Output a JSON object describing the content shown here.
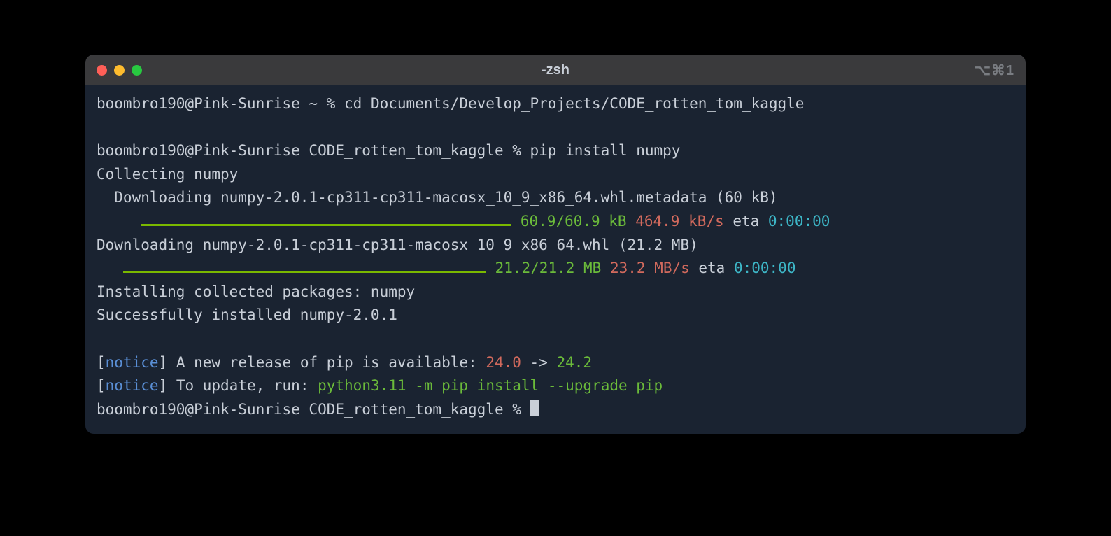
{
  "window": {
    "title": "-zsh",
    "shortcut": "⌥⌘1"
  },
  "lines": {
    "l1_prompt": "boombro190@Pink-Sunrise ~ % ",
    "l1_cmd": "cd Documents/Develop_Projects/CODE_rotten_tom_kaggle",
    "l2_prompt": "boombro190@Pink-Sunrise CODE_rotten_tom_kaggle % ",
    "l2_cmd": "pip install numpy",
    "collecting": "Collecting numpy",
    "dl_meta": "  Downloading numpy-2.0.1-cp311-cp311-macosx_10_9_x86_64.whl.metadata (60 kB)",
    "prog1_indent": "     ",
    "prog1_size": " 60.9/60.9 kB",
    "prog1_speed": " 464.9 kB/s",
    "prog1_eta_label": " eta ",
    "prog1_eta": "0:00:00",
    "dl_wheel": "Downloading numpy-2.0.1-cp311-cp311-macosx_10_9_x86_64.whl (21.2 MB)",
    "prog2_indent": "   ",
    "prog2_size": " 21.2/21.2 MB",
    "prog2_speed": " 23.2 MB/s",
    "prog2_eta_label": " eta ",
    "prog2_eta": "0:00:00",
    "installing": "Installing collected packages: numpy",
    "success": "Successfully installed numpy-2.0.1",
    "notice1_lb": "[",
    "notice1_tag": "notice",
    "notice1_rb": "] ",
    "notice1_text": "A new release of pip is available: ",
    "notice1_from": "24.0",
    "notice1_arrow": " -> ",
    "notice1_to": "24.2",
    "notice2_lb": "[",
    "notice2_tag": "notice",
    "notice2_rb": "] ",
    "notice2_text": "To update, run: ",
    "notice2_cmd": "python3.11 -m pip install --upgrade pip",
    "l3_prompt": "boombro190@Pink-Sunrise CODE_rotten_tom_kaggle % "
  }
}
